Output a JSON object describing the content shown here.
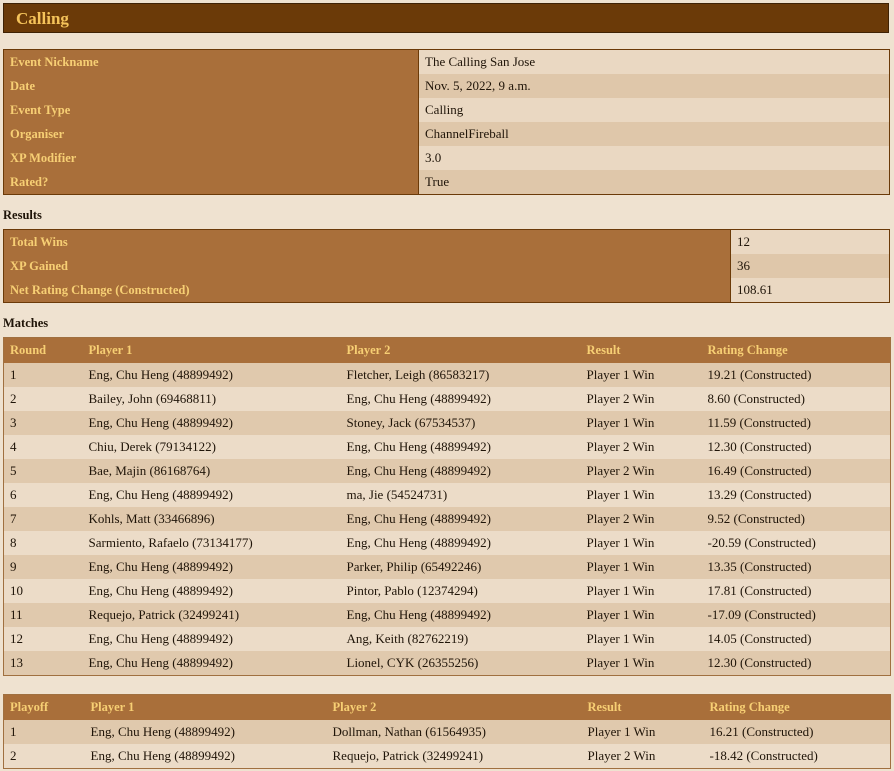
{
  "header": {
    "title": "Calling"
  },
  "event_info": [
    {
      "label": "Event Nickname",
      "value": "The Calling San Jose"
    },
    {
      "label": "Date",
      "value": "Nov. 5, 2022, 9 a.m."
    },
    {
      "label": "Event Type",
      "value": "Calling"
    },
    {
      "label": "Organiser",
      "value": "ChannelFireball"
    },
    {
      "label": "XP Modifier",
      "value": "3.0"
    },
    {
      "label": "Rated?",
      "value": "True"
    }
  ],
  "results": {
    "heading": "Results",
    "rows": [
      {
        "label": "Total Wins",
        "value": "12"
      },
      {
        "label": "XP Gained",
        "value": "36"
      },
      {
        "label": "Net Rating Change (Constructed)",
        "value": "108.61"
      }
    ]
  },
  "matches": {
    "heading": "Matches",
    "columns": [
      "Round",
      "Player 1",
      "Player 2",
      "Result",
      "Rating Change"
    ],
    "rows": [
      [
        "1",
        "Eng, Chu Heng (48899492)",
        "Fletcher, Leigh (86583217)",
        "Player 1 Win",
        "19.21 (Constructed)"
      ],
      [
        "2",
        "Bailey, John (69468811)",
        "Eng, Chu Heng (48899492)",
        "Player 2 Win",
        "8.60 (Constructed)"
      ],
      [
        "3",
        "Eng, Chu Heng (48899492)",
        "Stoney, Jack (67534537)",
        "Player 1 Win",
        "11.59 (Constructed)"
      ],
      [
        "4",
        "Chiu, Derek (79134122)",
        "Eng, Chu Heng (48899492)",
        "Player 2 Win",
        "12.30 (Constructed)"
      ],
      [
        "5",
        "Bae, Majin (86168764)",
        "Eng, Chu Heng (48899492)",
        "Player 2 Win",
        "16.49 (Constructed)"
      ],
      [
        "6",
        "Eng, Chu Heng (48899492)",
        "ma, Jie (54524731)",
        "Player 1 Win",
        "13.29 (Constructed)"
      ],
      [
        "7",
        "Kohls, Matt (33466896)",
        "Eng, Chu Heng (48899492)",
        "Player 2 Win",
        "9.52 (Constructed)"
      ],
      [
        "8",
        "Sarmiento, Rafaelo (73134177)",
        "Eng, Chu Heng (48899492)",
        "Player 1 Win",
        "-20.59 (Constructed)"
      ],
      [
        "9",
        "Eng, Chu Heng (48899492)",
        "Parker, Philip (65492246)",
        "Player 1 Win",
        "13.35 (Constructed)"
      ],
      [
        "10",
        "Eng, Chu Heng (48899492)",
        "Pintor, Pablo (12374294)",
        "Player 1 Win",
        "17.81 (Constructed)"
      ],
      [
        "11",
        "Requejo, Patrick (32499241)",
        "Eng, Chu Heng (48899492)",
        "Player 1 Win",
        "-17.09 (Constructed)"
      ],
      [
        "12",
        "Eng, Chu Heng (48899492)",
        "Ang, Keith (82762219)",
        "Player 1 Win",
        "14.05 (Constructed)"
      ],
      [
        "13",
        "Eng, Chu Heng (48899492)",
        "Lionel, CYK (26355256)",
        "Player 1 Win",
        "12.30 (Constructed)"
      ]
    ]
  },
  "playoffs": {
    "columns": [
      "Playoff",
      "Player 1",
      "Player 2",
      "Result",
      "Rating Change"
    ],
    "rows": [
      [
        "1",
        "Eng, Chu Heng (48899492)",
        "Dollman, Nathan (61564935)",
        "Player 1 Win",
        "16.21 (Constructed)"
      ],
      [
        "2",
        "Eng, Chu Heng (48899492)",
        "Requejo, Patrick (32499241)",
        "Player 2 Win",
        "-18.42 (Constructed)"
      ]
    ]
  }
}
